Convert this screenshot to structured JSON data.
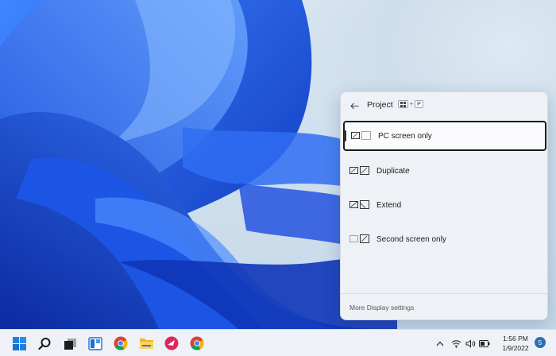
{
  "panel": {
    "title": "Project",
    "shortcut_plus": "+",
    "shortcut_key": "P",
    "options": [
      {
        "label": "PC screen only",
        "selected": true
      },
      {
        "label": "Duplicate",
        "selected": false
      },
      {
        "label": "Extend",
        "selected": false
      },
      {
        "label": "Second screen only",
        "selected": false
      }
    ],
    "more_settings": "More Display settings"
  },
  "taskbar": {
    "apps": [
      "start-icon",
      "search-icon",
      "task-view-icon",
      "widgets-icon",
      "chrome-icon",
      "file-explorer-icon",
      "app-icon",
      "chrome-icon"
    ],
    "clock": {
      "time": "1:56 PM",
      "date": "1/9/2022"
    },
    "notification_count": "5"
  },
  "colors": {
    "accent": "#1b1b1b",
    "wallpaper_blue": "#1f5fe0",
    "panel_bg": "#eef1f6",
    "taskbar_bg": "#eef2f7"
  }
}
